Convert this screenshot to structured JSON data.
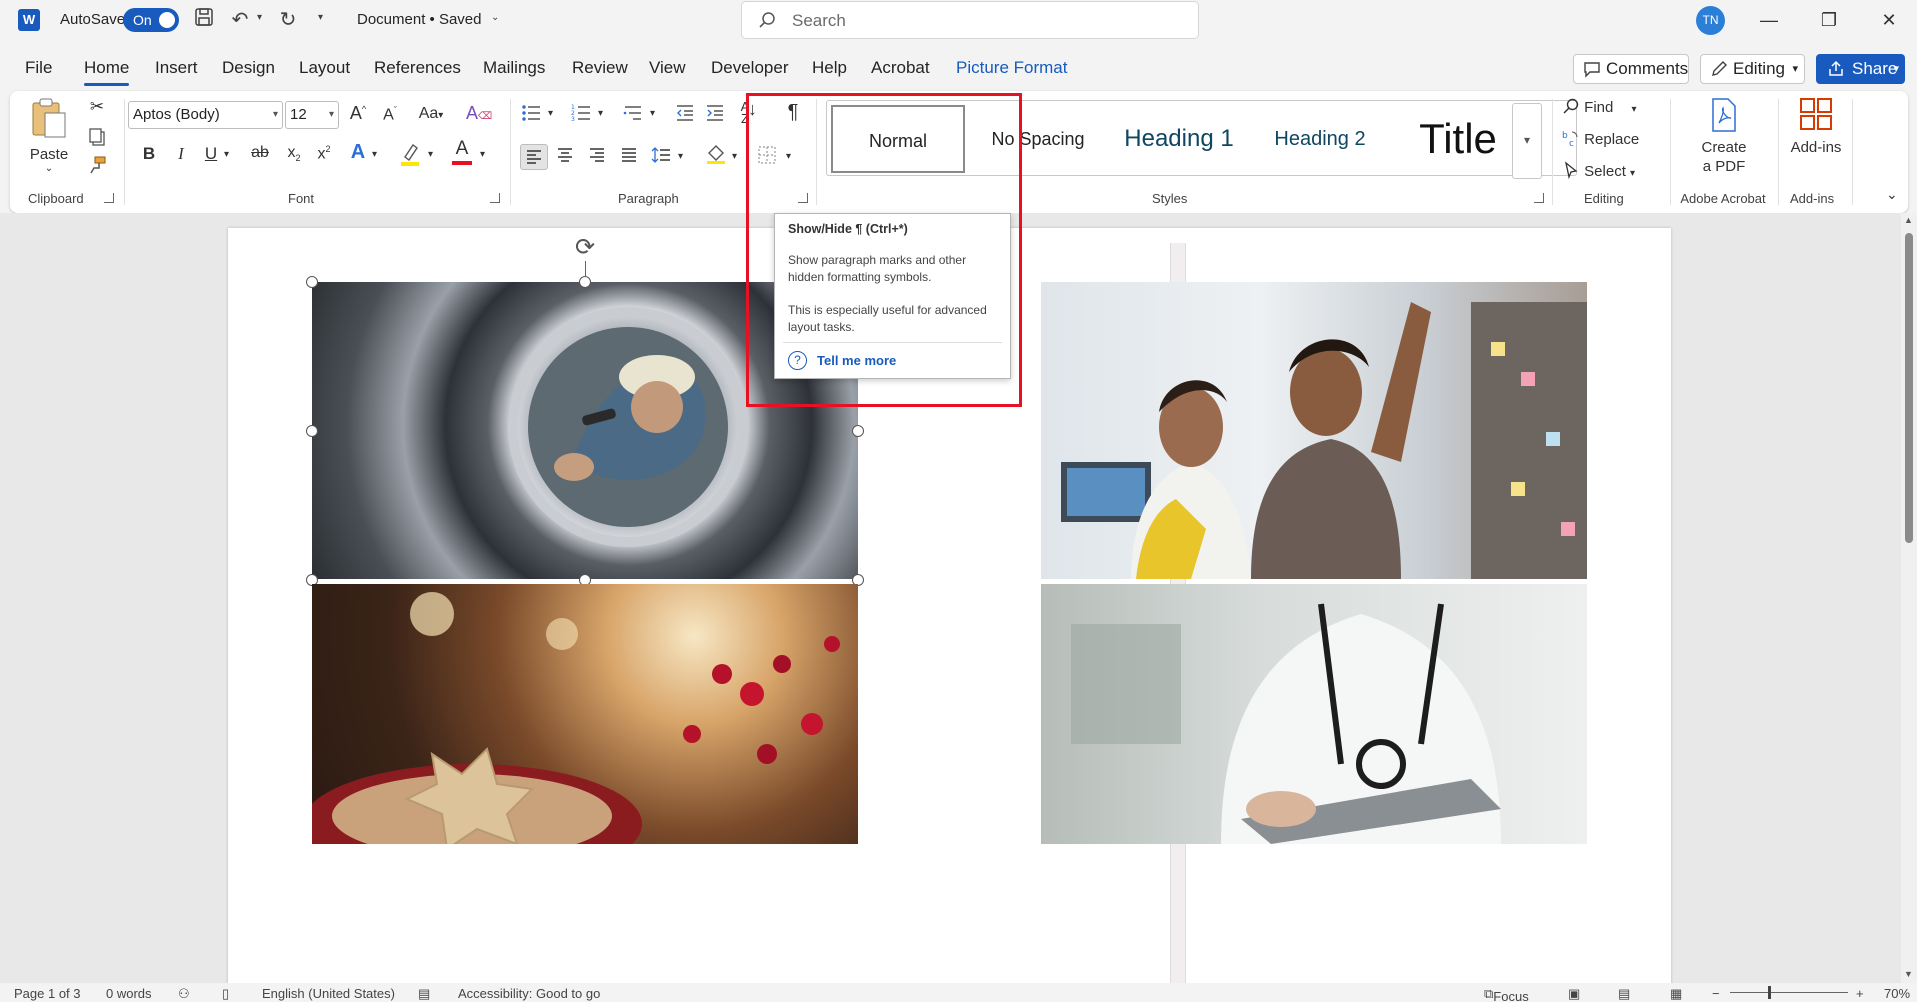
{
  "titlebar": {
    "app_icon": "word-logo",
    "app_letter": "W",
    "autosave_label": "AutoSave",
    "autosave_state": "On",
    "doc_title": "Document • Saved",
    "search_placeholder": "Search",
    "avatar_initials": "TN"
  },
  "menu": {
    "tabs": [
      "File",
      "Home",
      "Insert",
      "Design",
      "Layout",
      "References",
      "Mailings",
      "Review",
      "View",
      "Developer",
      "Help",
      "Acrobat",
      "Picture Format"
    ],
    "active_tab": "Home",
    "comments_label": "Comments",
    "editing_label": "Editing",
    "share_label": "Share"
  },
  "ribbon": {
    "clipboard": {
      "label": "Clipboard",
      "paste_label": "Paste"
    },
    "font": {
      "label": "Font",
      "font_name": "Aptos (Body)",
      "font_size": "12",
      "case_label": "Aa"
    },
    "paragraph": {
      "label": "Paragraph"
    },
    "styles": {
      "label": "Styles",
      "items": [
        "Normal",
        "No Spacing",
        "Heading 1",
        "Heading 2",
        "Title"
      ],
      "selected": "Normal"
    },
    "editing": {
      "label": "Editing",
      "find": "Find",
      "replace": "Replace",
      "select": "Select"
    },
    "acrobat": {
      "label": "Adobe Acrobat",
      "create_pdf_line1": "Create",
      "create_pdf_line2": "a PDF"
    },
    "addins": {
      "label": "Add-ins",
      "button": "Add-ins"
    }
  },
  "tooltip": {
    "title": "Show/Hide ¶ (Ctrl+*)",
    "body1": "Show paragraph marks and other hidden formatting symbols.",
    "body2": "This is especially useful for advanced layout tasks.",
    "link": "Tell me more"
  },
  "statusbar": {
    "page": "Page 1 of 3",
    "words": "0 words",
    "language": "English (United States)",
    "accessibility": "Accessibility: Good to go",
    "focus": "Focus",
    "zoom": "70%"
  },
  "colors": {
    "accent": "#185abd",
    "highlight_box": "#e81123",
    "font_color_bar": "#e81123",
    "highlighter_bar": "#ffe600"
  }
}
